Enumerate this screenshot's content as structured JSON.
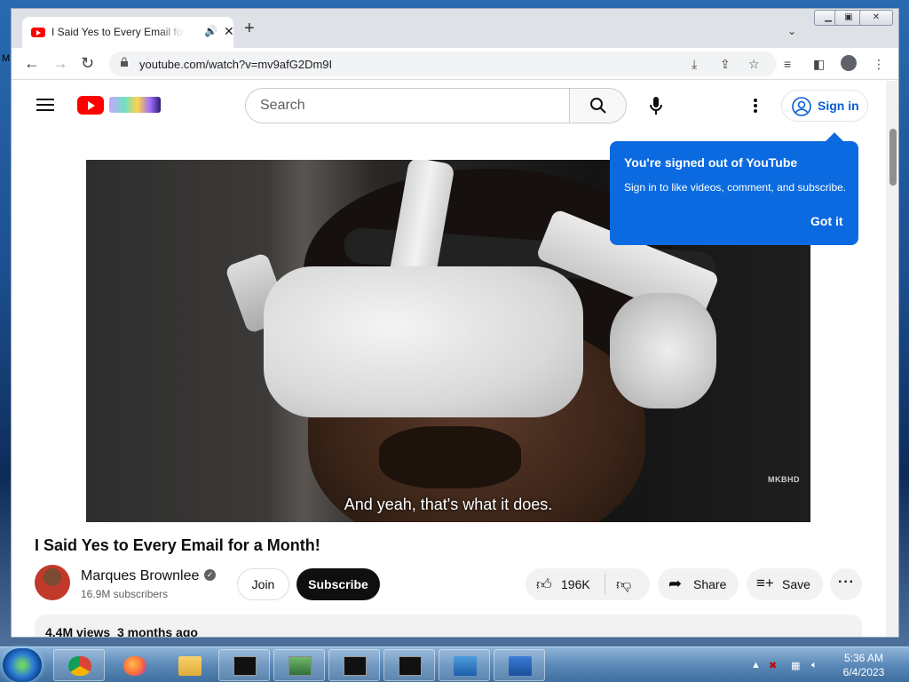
{
  "desktop": {
    "edge_letter": "M"
  },
  "browser": {
    "tab": {
      "title": "I Said Yes to Every Email for a Month!",
      "close": "✕"
    },
    "new_tab": "+",
    "url": "youtube.com/watch?v=mv9afG2Dm9I"
  },
  "youtube": {
    "search_placeholder": "Search",
    "sign_in": "Sign in",
    "tooltip": {
      "heading": "You're signed out of YouTube",
      "body": "Sign in to like videos, comment, and subscribe.",
      "button": "Got it"
    },
    "video": {
      "caption": "And yeah, that's what it does.",
      "watermark": "MKBHD",
      "title": "I Said Yes to Every Email for a Month!"
    },
    "channel": {
      "name": "Marques Brownlee",
      "subscribers": "16.9M subscribers"
    },
    "join": "Join",
    "subscribe": "Subscribe",
    "likes": "196K",
    "share": "Share",
    "save": "Save",
    "description": {
      "views": "4.4M views",
      "date": "3 months ago"
    }
  },
  "taskbar": {
    "time": "5:36 AM",
    "date": "6/4/2023"
  }
}
